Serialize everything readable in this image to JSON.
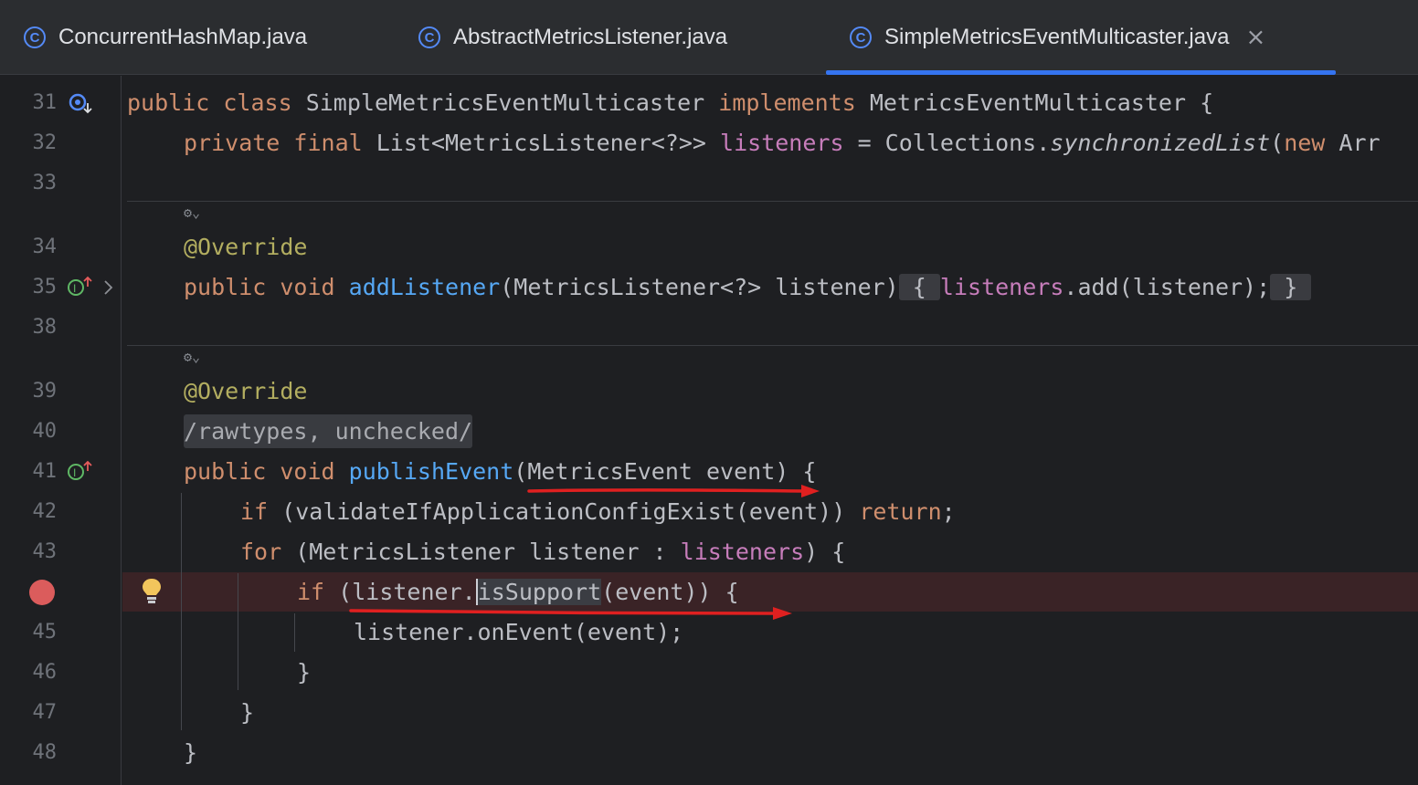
{
  "tabs": [
    {
      "label": "ConcurrentHashMap.java",
      "icon": "class-icon"
    },
    {
      "label": "AbstractMetricsListener.java",
      "icon": "class-icon"
    },
    {
      "label": "SimpleMetricsEventMulticaster.java",
      "icon": "class-icon",
      "active": true
    }
  ],
  "tab_close": "×",
  "class_icon_glyph": "C",
  "line_numbers": [
    "31",
    "32",
    "33",
    "34",
    "35",
    "38",
    "39",
    "40",
    "41",
    "42",
    "43",
    "",
    "45",
    "46",
    "47",
    "48"
  ],
  "code": {
    "l31": {
      "kw1": "public",
      "kw2": "class",
      "name": "SimpleMetricsEventMulticaster",
      "kw3": "implements",
      "iface": "MetricsEventMulticaster {"
    },
    "l32": {
      "kw1": "private",
      "kw2": "final",
      "type": "List<MetricsListener<?>>",
      "field": "listeners",
      "eq": " = Collections.",
      "method": "synchronizedList",
      "paren": "(",
      "kw3": "new",
      "rest": " Arr"
    },
    "l34": {
      "ann": "@Override"
    },
    "l35": {
      "kw1": "public",
      "kw2": "void",
      "fn": "addListener",
      "params": "(MetricsListener<?> listener)",
      "ob": "{",
      "field": "listeners",
      "call": ".add(listener);",
      "cb": "}"
    },
    "l39": {
      "ann": "@Override"
    },
    "l40": {
      "comment": "/rawtypes, unchecked/"
    },
    "l41": {
      "kw1": "public",
      "kw2": "void",
      "fn": "publishEvent",
      "params": "(MetricsEvent event) {"
    },
    "l42": {
      "kw1": "if",
      "cond": " (validateIfApplicationConfigExist(event)) ",
      "kw2": "return",
      ";": ";"
    },
    "l43": {
      "kw1": "for",
      "loop": " (MetricsListener listener : ",
      "field": "listeners",
      ") {": ") {"
    },
    "l44": {
      "kw1": "if",
      "pre": " (listener.",
      "mid": "isSupport",
      "post": "(event)) {"
    },
    "l45": {
      "text": "listener.onEvent(event);"
    },
    "l46": {
      "text": "}"
    },
    "l47": {
      "text": "}"
    },
    "l48": {
      "text": "}"
    }
  },
  "inlay_hint": "⚙⌄",
  "colors": {
    "accent": "#3574f0",
    "breakpoint": "#db5c5c",
    "annotation_arrow": "#e02020"
  }
}
